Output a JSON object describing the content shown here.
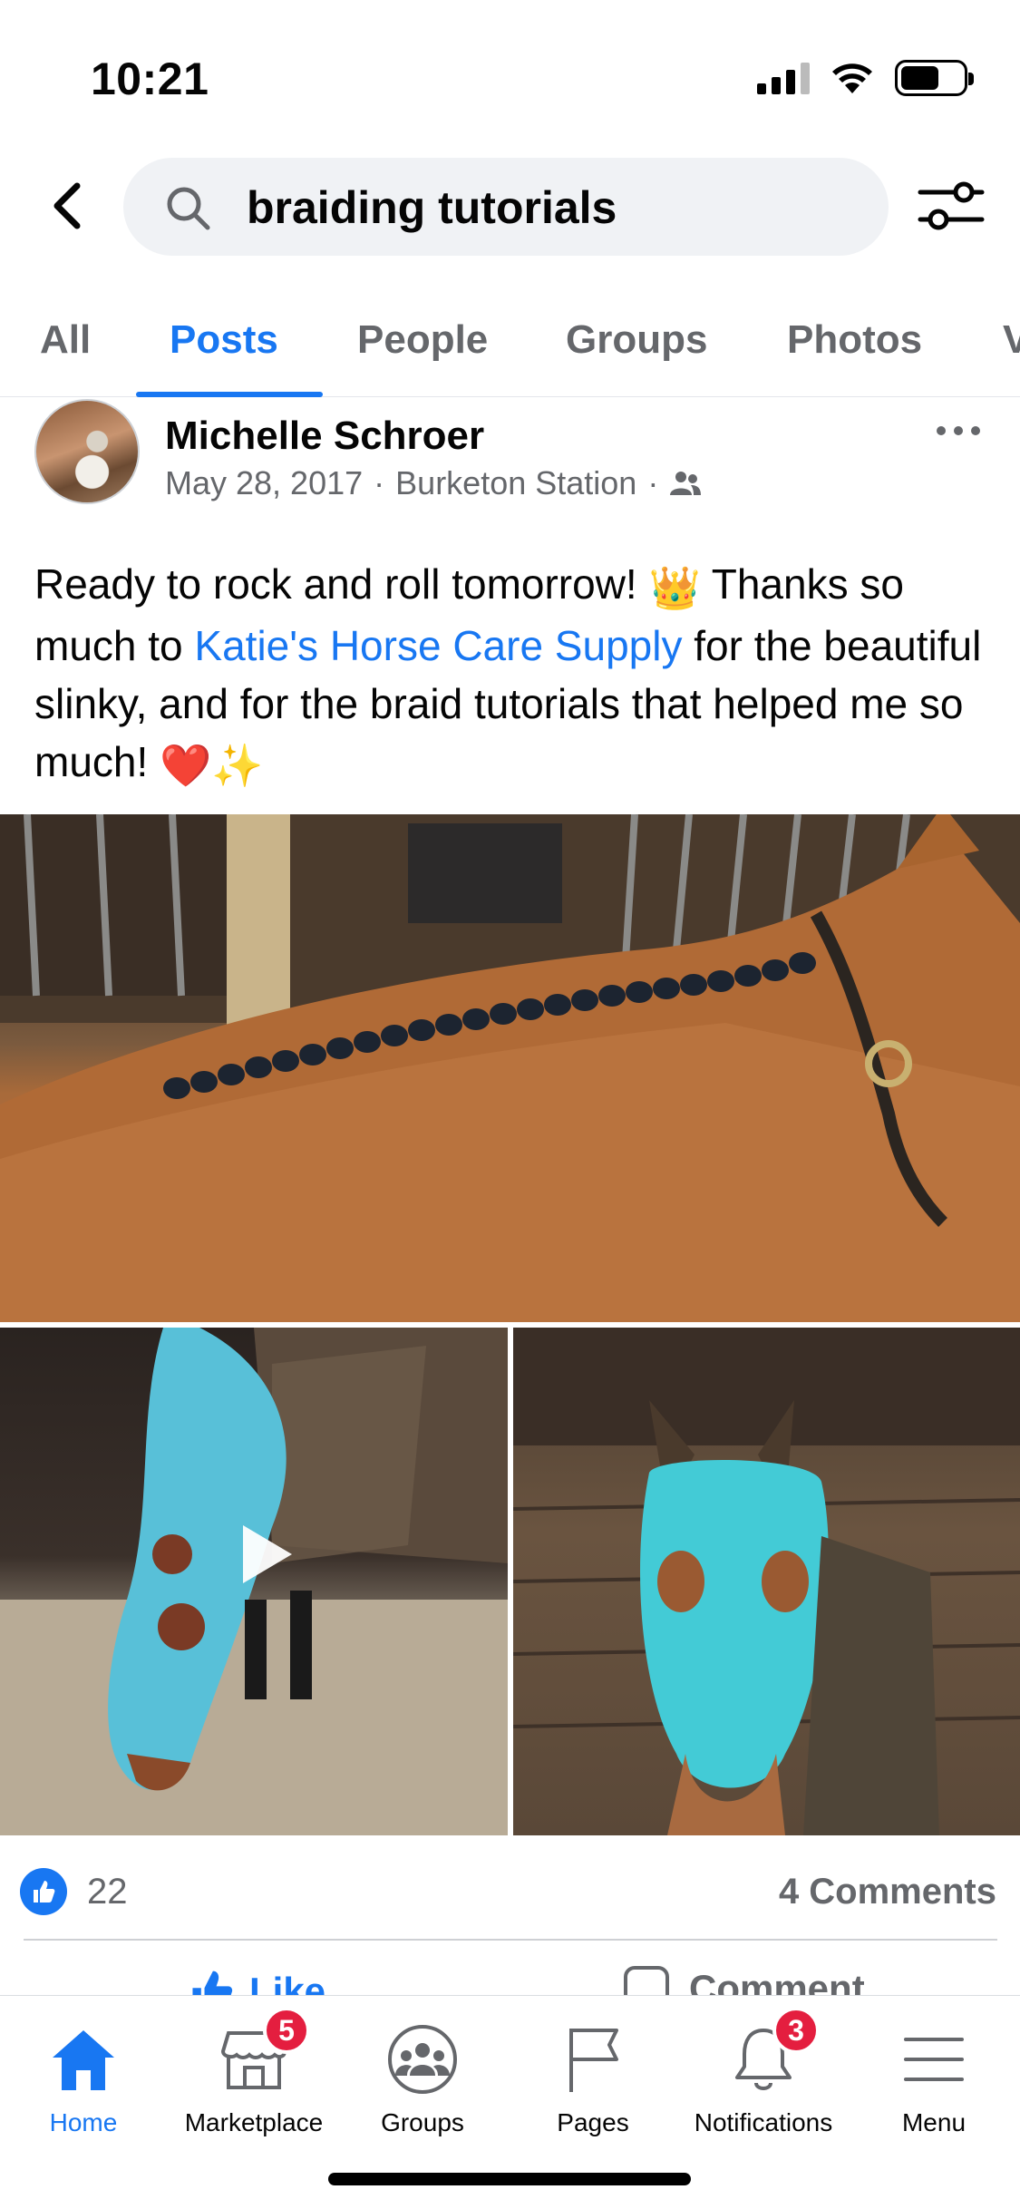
{
  "status_bar": {
    "time": "10:21"
  },
  "search": {
    "query": "braiding tutorials"
  },
  "tabs": [
    {
      "label": "All",
      "active": false
    },
    {
      "label": "Posts",
      "active": true
    },
    {
      "label": "People",
      "active": false
    },
    {
      "label": "Groups",
      "active": false
    },
    {
      "label": "Photos",
      "active": false
    },
    {
      "label": "V",
      "active": false
    }
  ],
  "post": {
    "author": "Michelle Schroer",
    "date": "May 28, 2017",
    "location": "Burketon Station",
    "separator": "·",
    "text_1": "Ready to rock and roll tomorrow! ",
    "emoji_crown": "👑",
    "text_2": " Thanks so much to ",
    "link": "Katie's Horse Care Supply",
    "text_3": " for the beautiful slinky, and for the braid tutorials that helped me so much! ",
    "emoji_heart": "❤️",
    "emoji_sparkles": "✨",
    "like_count": "22",
    "comments_count": "4 Comments",
    "like_label": "Like",
    "comment_label": "Comment"
  },
  "nav": [
    {
      "label": "Home",
      "icon": "home-icon",
      "active": true,
      "badge": ""
    },
    {
      "label": "Marketplace",
      "icon": "marketplace-icon",
      "active": false,
      "badge": "5"
    },
    {
      "label": "Groups",
      "icon": "groups-icon",
      "active": false,
      "badge": ""
    },
    {
      "label": "Pages",
      "icon": "flag-icon",
      "active": false,
      "badge": ""
    },
    {
      "label": "Notifications",
      "icon": "bell-icon",
      "active": false,
      "badge": "3"
    },
    {
      "label": "Menu",
      "icon": "hamburger-icon",
      "active": false,
      "badge": ""
    }
  ],
  "colors": {
    "accent": "#1877f2",
    "badge": "#e41e3f",
    "muted": "#65676b"
  }
}
